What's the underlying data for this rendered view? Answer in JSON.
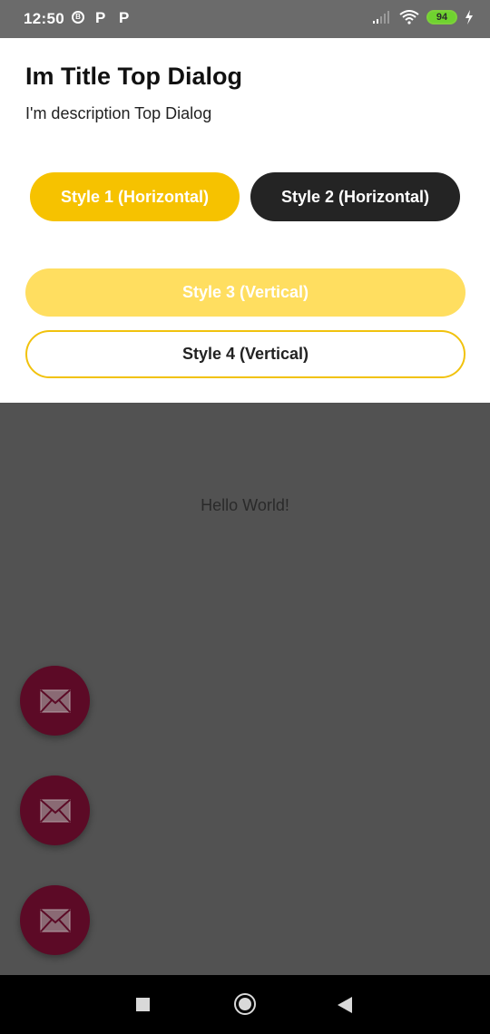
{
  "status_bar": {
    "time": "12:50",
    "notification_icons": [
      "circle-b-icon",
      "p-icon",
      "p-icon"
    ],
    "p_glyph": "P",
    "circle_glyph": "B",
    "battery_level": "94",
    "signal_icon": "signal-icon",
    "wifi_icon": "wifi-icon",
    "charging_icon": "charging-bolt-icon"
  },
  "dialog": {
    "title": "Im Title Top Dialog",
    "description": "I'm description Top Dialog",
    "buttons": {
      "style1_label": "Style 1 (Horizontal)",
      "style2_label": "Style 2 (Horizontal)",
      "style3_label": "Style 3 (Vertical)",
      "style4_label": "Style 4 (Vertical)"
    }
  },
  "content": {
    "hello_text": "Hello World!"
  },
  "fabs": [
    {
      "icon": "mail-icon"
    },
    {
      "icon": "mail-icon"
    },
    {
      "icon": "mail-icon"
    }
  ],
  "colors": {
    "accent_yellow": "#f6c200",
    "light_yellow": "#ffde60",
    "dark_button": "#242424",
    "fab": "#5c0a26",
    "scrim": "#525252",
    "battery_green": "#6fd32f"
  }
}
